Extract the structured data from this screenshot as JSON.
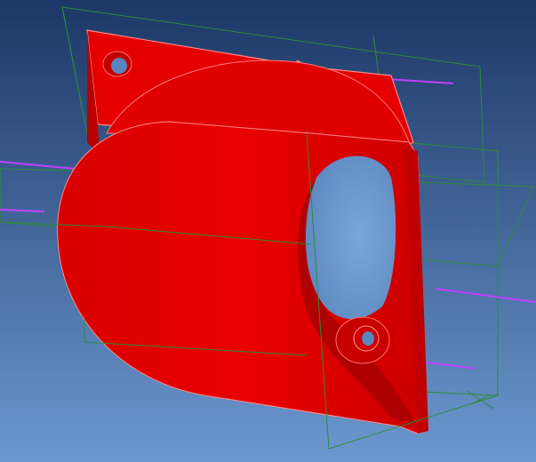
{
  "viewport": {
    "background_top": "#1c3766",
    "background_bottom": "#6c98cf"
  },
  "model": {
    "body_color": "#e50000",
    "body_shade": "#b80000",
    "body_highlight": "#ff3030",
    "hole_color": "#6e9bd0",
    "edge_color": "#ff8a8a"
  },
  "overlay": {
    "datum_plane_color": "#2e8b3a",
    "datum_axis_color": "#c040ff"
  }
}
